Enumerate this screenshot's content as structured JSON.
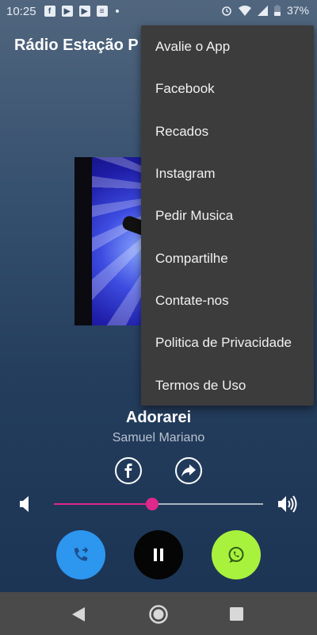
{
  "status_bar": {
    "time": "10:25",
    "battery": "37%",
    "icons": [
      "facebook-icon",
      "youtube-icon",
      "youtube-icon",
      "notification-icon",
      "alarm-icon",
      "wifi-icon",
      "signal-icon",
      "battery-icon"
    ]
  },
  "app_bar": {
    "title": "Rádio Estação P"
  },
  "menu": {
    "items": [
      "Avalie o App",
      "Facebook",
      "Recados",
      "Instagram",
      "Pedir Musica",
      "Compartilhe",
      "Contate-nos",
      "Politica de Privacidade",
      "Termos de Uso"
    ]
  },
  "player": {
    "song_title": "Adorarei",
    "artist": "Samuel Mariano",
    "volume_level": 0.47
  },
  "colors": {
    "accent": "#e0288a",
    "call_button": "#2d96ee",
    "pause_button": "#050505",
    "whatsapp_button": "#a8f23e",
    "menu_background": "#3c3c3c"
  }
}
